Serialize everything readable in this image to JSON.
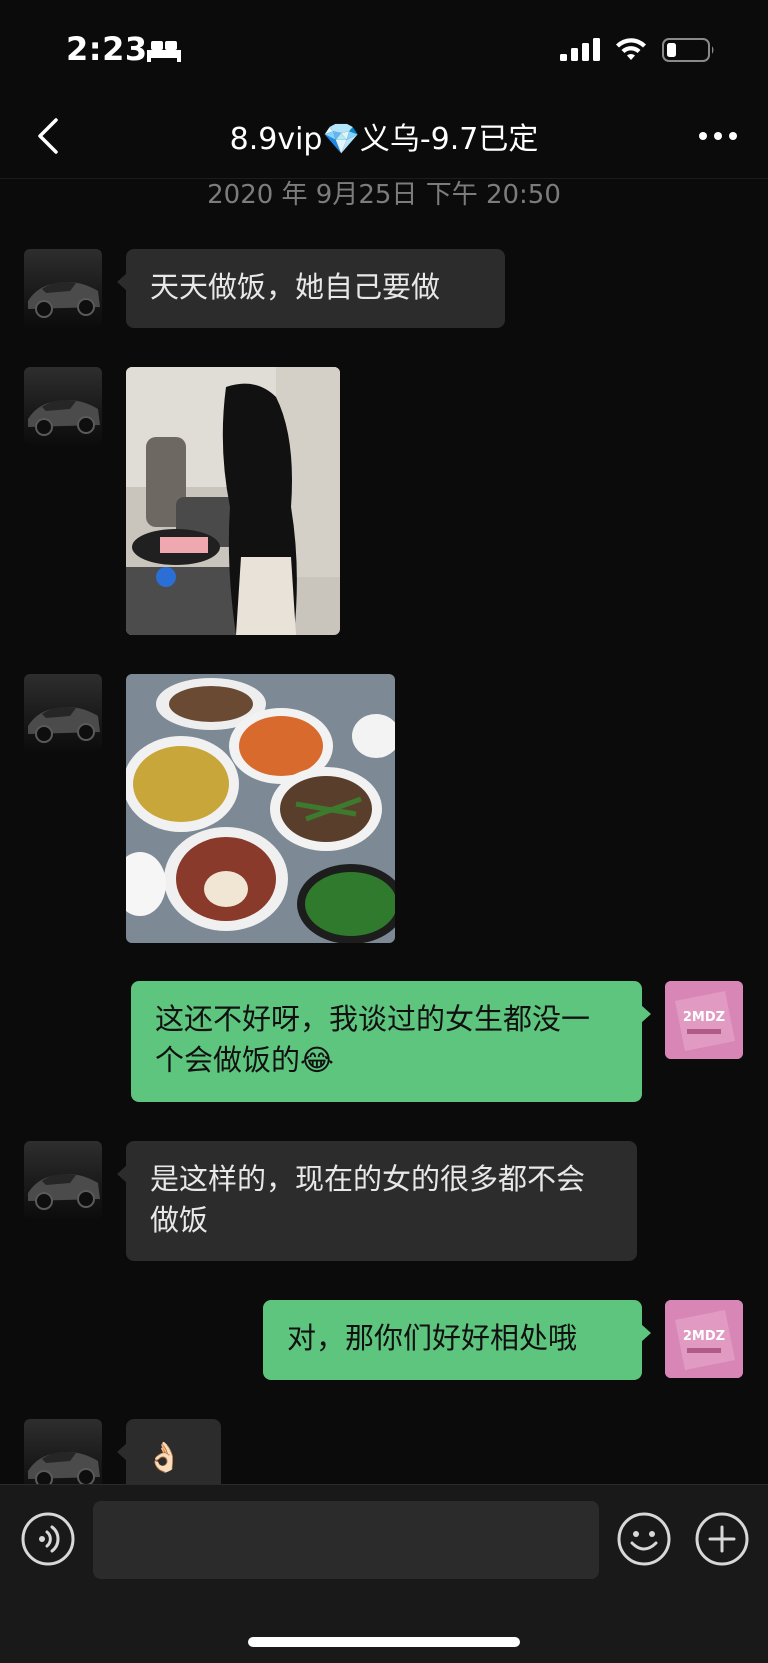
{
  "status_bar": {
    "time": "2:23"
  },
  "header": {
    "title": "8.9vip💎义乌-9.7已定"
  },
  "timestamp": "2020 年 9月25日 下午 20:50",
  "messages": [
    {
      "sender": "other",
      "type": "text",
      "text": "天天做饭，她自己要做"
    },
    {
      "sender": "other",
      "type": "image",
      "description": "photo"
    },
    {
      "sender": "other",
      "type": "image",
      "description": "photo"
    },
    {
      "sender": "self",
      "type": "text",
      "text": "这还不好呀，我谈过的女生都没一个会做饭的😂"
    },
    {
      "sender": "other",
      "type": "text",
      "text": "是这样的，现在的女的很多都不会做饭"
    },
    {
      "sender": "self",
      "type": "text",
      "text": "对，那你们好好相处哦"
    },
    {
      "sender": "other",
      "type": "text",
      "text": "👌🏻"
    }
  ],
  "input": {
    "placeholder": ""
  },
  "colors": {
    "outgoing_bubble": "#5ec57e",
    "incoming_bubble": "#2c2c2c",
    "background": "#0b0b0b"
  }
}
